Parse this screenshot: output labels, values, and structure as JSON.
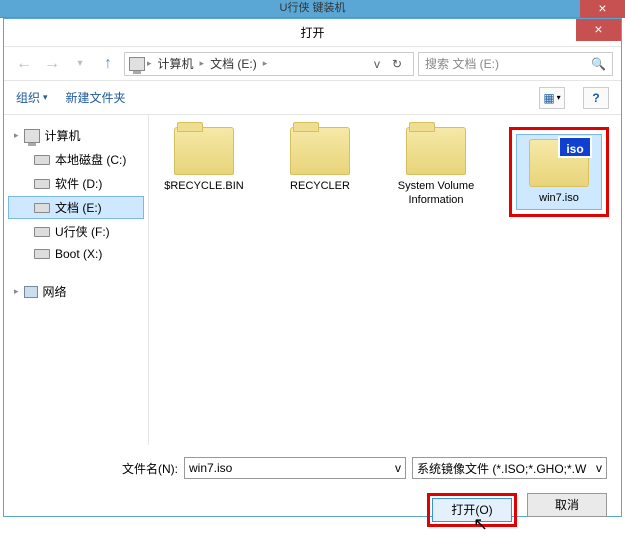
{
  "outer": {
    "bg_title": "U行侠  键装机"
  },
  "dialog": {
    "title": "打开",
    "close_glyph": "×"
  },
  "nav": {
    "back_glyph": "←",
    "fwd_glyph": "→",
    "history_glyph": "▾",
    "up_glyph": "↑",
    "refresh_glyph": "↻",
    "drop_glyph": "v"
  },
  "breadcrumb": {
    "parts": [
      "计算机",
      "文档 (E:)"
    ]
  },
  "search": {
    "placeholder": "搜索 文档 (E:)",
    "icon_glyph": "🔍"
  },
  "toolbar": {
    "organize": "组织",
    "new_folder": "新建文件夹",
    "drop_glyph": "▾",
    "view_glyph": "▦",
    "help_glyph": "?"
  },
  "sidebar": {
    "root": "计算机",
    "items": [
      {
        "label": "本地磁盘 (C:)"
      },
      {
        "label": "软件 (D:)"
      },
      {
        "label": "文档 (E:)"
      },
      {
        "label": "U行侠 (F:)"
      },
      {
        "label": "Boot (X:)"
      }
    ],
    "network": "网络"
  },
  "items": {
    "a": "$RECYCLE.BIN",
    "b": "RECYCLER",
    "c": "System Volume Information",
    "d": "win7.iso",
    "iso_badge": "iso"
  },
  "bottom": {
    "filename_label": "文件名(N):",
    "filename_value": "win7.iso",
    "filter_text": "系统镜像文件 (*.ISO;*.GHO;*.W",
    "open_btn": "打开(O)",
    "cancel_btn": "取消",
    "drop_glyph": "v"
  }
}
